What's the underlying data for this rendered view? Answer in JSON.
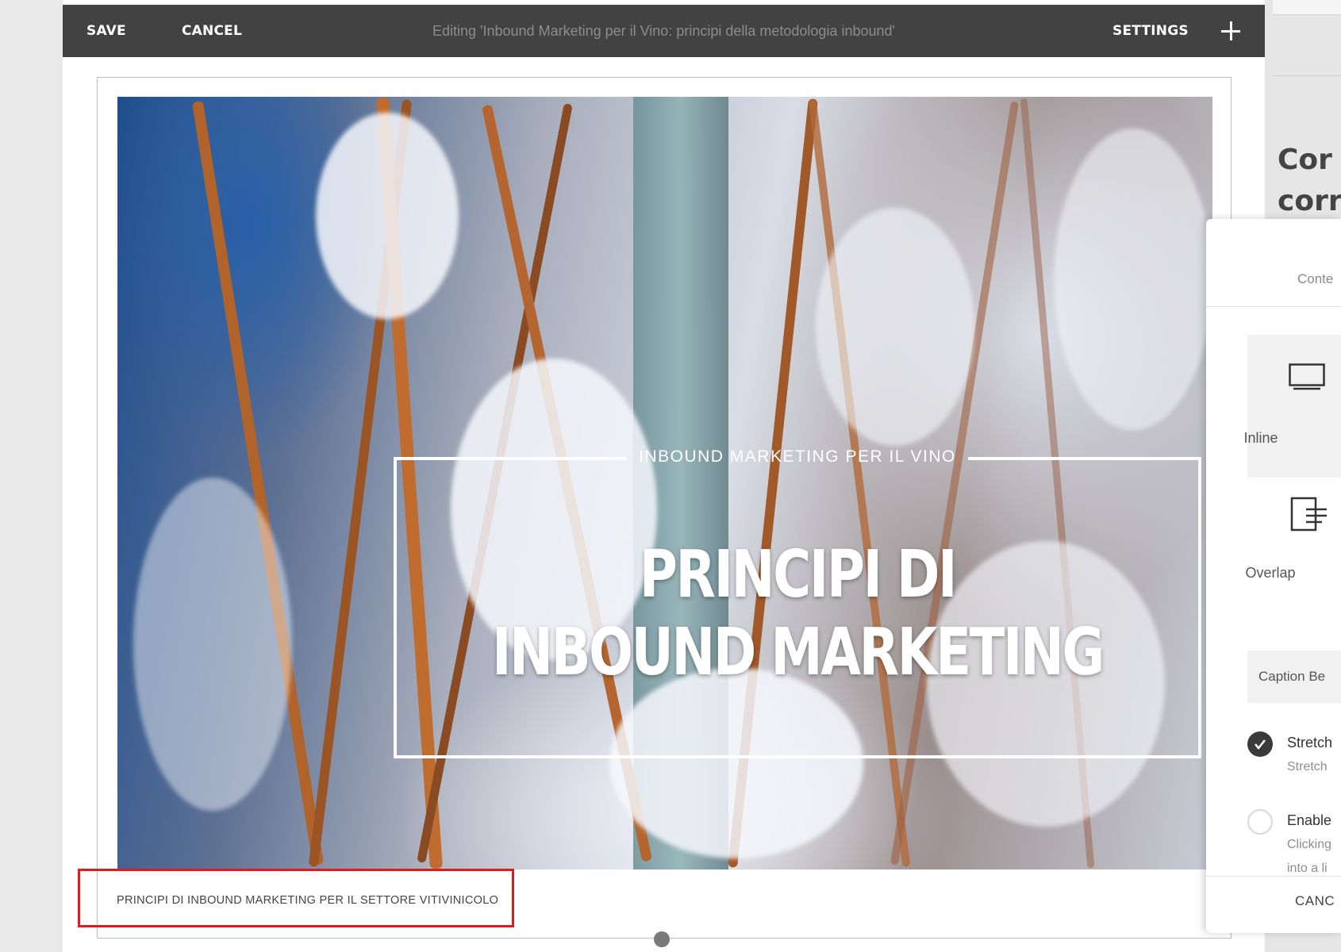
{
  "toolbar": {
    "save_label": "SAVE",
    "cancel_label": "CANCEL",
    "title": "Editing 'Inbound Marketing per il Vino: principi della metodologia inbound'",
    "settings_label": "SETTINGS"
  },
  "hero": {
    "kicker": "INBOUND MARKETING PER IL VINO",
    "headline_line1": "PRINCIPI DI",
    "headline_line2": "INBOUND MARKETING",
    "caption": "PRINCIPI DI INBOUND MARKETING PER IL SETTORE VITIVINICOLO"
  },
  "background_page": {
    "heading_line1": "Cor",
    "heading_line2": "corr"
  },
  "panel": {
    "tab_label": "Conte",
    "layouts": [
      {
        "label": "Inline",
        "icon": "monitor-icon"
      },
      {
        "label": "Overlap",
        "icon": "overlap-layout-icon"
      }
    ],
    "caption_behavior": "Caption Be",
    "options": [
      {
        "title": "Stretch",
        "subtitle": "Stretch",
        "checked": true
      },
      {
        "title": "Enable",
        "subtitle": "Clicking",
        "subtitle2": "into a li",
        "checked": false
      }
    ],
    "cancel_label": "CANC"
  },
  "colors": {
    "toolbar_bg": "#424242",
    "highlight_border": "#e01b1b",
    "hero_text": "#ffffff"
  }
}
